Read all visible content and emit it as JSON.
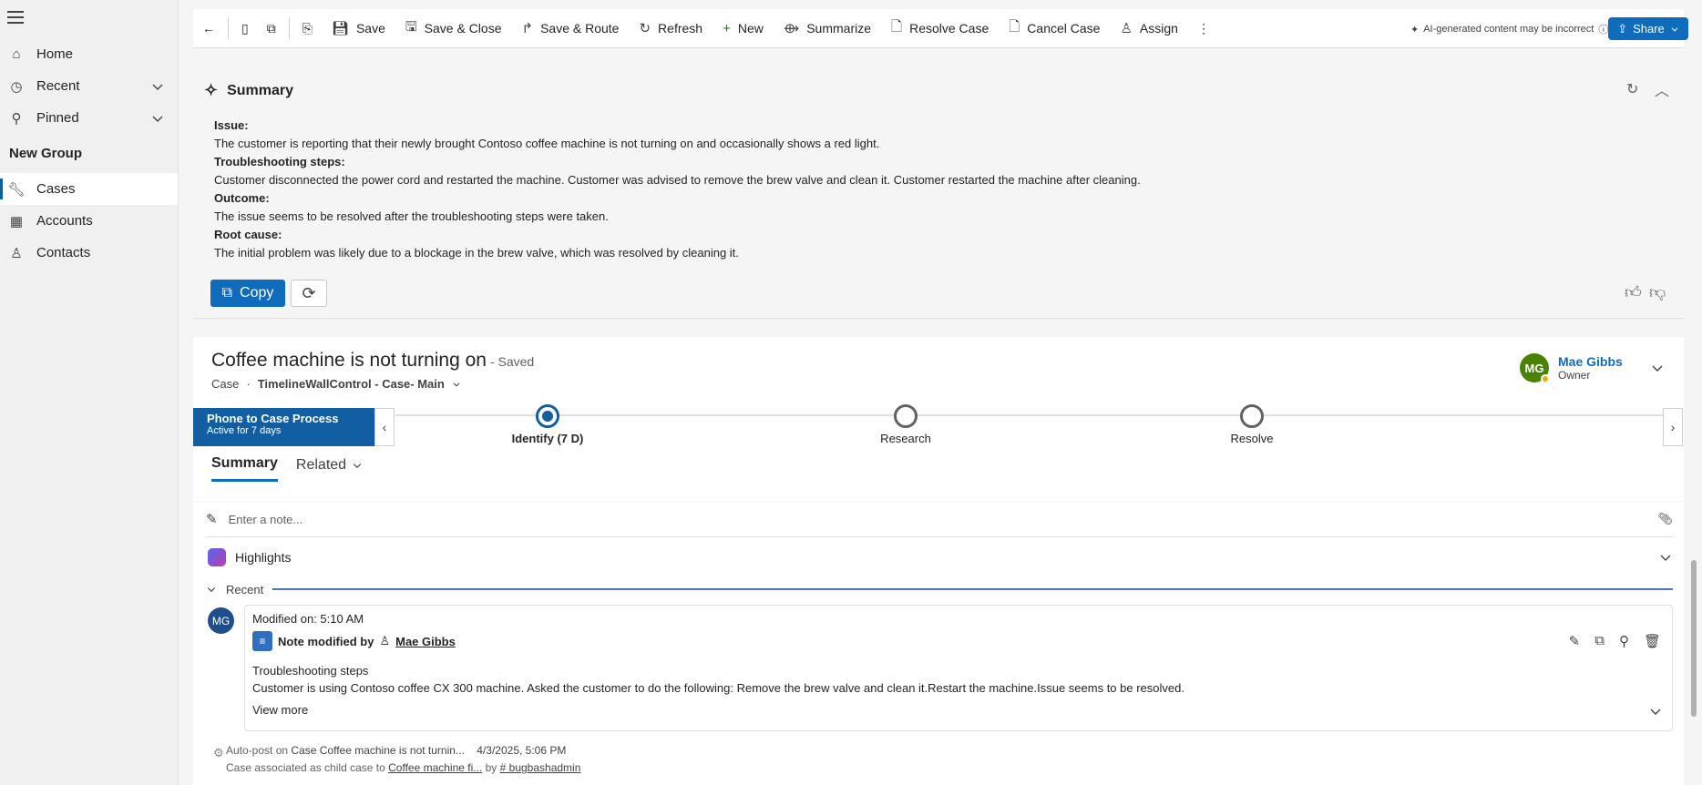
{
  "sidebar": {
    "items": [
      {
        "label": "Home",
        "icon": "home-icon"
      },
      {
        "label": "Recent",
        "icon": "clock-icon"
      },
      {
        "label": "Pinned",
        "icon": "pin-icon"
      }
    ],
    "group_title": "New Group",
    "group_items": [
      {
        "label": "Cases",
        "icon": "wrench-icon",
        "active": true
      },
      {
        "label": "Accounts",
        "icon": "building-icon"
      },
      {
        "label": "Contacts",
        "icon": "person-icon"
      }
    ]
  },
  "toolbar": {
    "save": "Save",
    "save_close": "Save & Close",
    "save_route": "Save & Route",
    "refresh": "Refresh",
    "new": "New",
    "summarize": "Summarize",
    "resolve_case": "Resolve Case",
    "cancel_case": "Cancel Case",
    "assign": "Assign",
    "ai_note": "AI-generated content may be incorrect",
    "share": "Share"
  },
  "summary": {
    "title": "Summary",
    "issue_label": "Issue:",
    "issue_text": "The customer is reporting that their newly brought Contoso coffee machine is not turning on and occasionally shows a red light.",
    "steps_label": "Troubleshooting steps:",
    "steps_text": "Customer disconnected the power cord and restarted the machine. Customer was advised to remove the brew valve and clean it. Customer restarted the machine after cleaning.",
    "outcome_label": "Outcome:",
    "outcome_text": "The issue seems to be resolved after the troubleshooting steps were taken.",
    "root_label": "Root cause:",
    "root_text": "The initial problem was likely due to a blockage in the brew valve, which was resolved by cleaning it.",
    "copy_label": "Copy"
  },
  "case": {
    "title": "Coffee machine is not turning on",
    "saved": "- Saved",
    "entity": "Case",
    "dot": "·",
    "form": "TimelineWallControl - Case- Main",
    "owner_initials": "MG",
    "owner_name": "Mae Gibbs",
    "owner_role": "Owner"
  },
  "process": {
    "name": "Phone to Case Process",
    "status": "Active for 7 days",
    "stages": [
      {
        "label": "Identify  (7 D)",
        "active": true
      },
      {
        "label": "Research",
        "active": false
      },
      {
        "label": "Resolve",
        "active": false
      }
    ]
  },
  "tabs": {
    "summary": "Summary",
    "related": "Related"
  },
  "timeline": {
    "note_placeholder": "Enter a note...",
    "highlights": "Highlights",
    "recent": "Recent",
    "post": {
      "avatar": "MG",
      "modified": "Modified on: 5:10 AM",
      "head_prefix": "Note modified by",
      "author": "Mae Gibbs",
      "line1": "Troubleshooting steps",
      "line2": "Customer is using Contoso coffee CX 300 machine. Asked the customer to do the following: Remove the brew valve and clean it.Restart  the machine.Issue seems to be resolved.",
      "view_more": "View more"
    },
    "auto_post": {
      "prefix": "Auto-post on",
      "case_link": "Case Coffee machine is not turnin...",
      "date": "4/3/2025, 5:06 PM",
      "line2_prefix": "Case associated as child case to",
      "child_link": "Coffee machine fi...",
      "by": "by",
      "user": "# bugbashadmin"
    }
  }
}
